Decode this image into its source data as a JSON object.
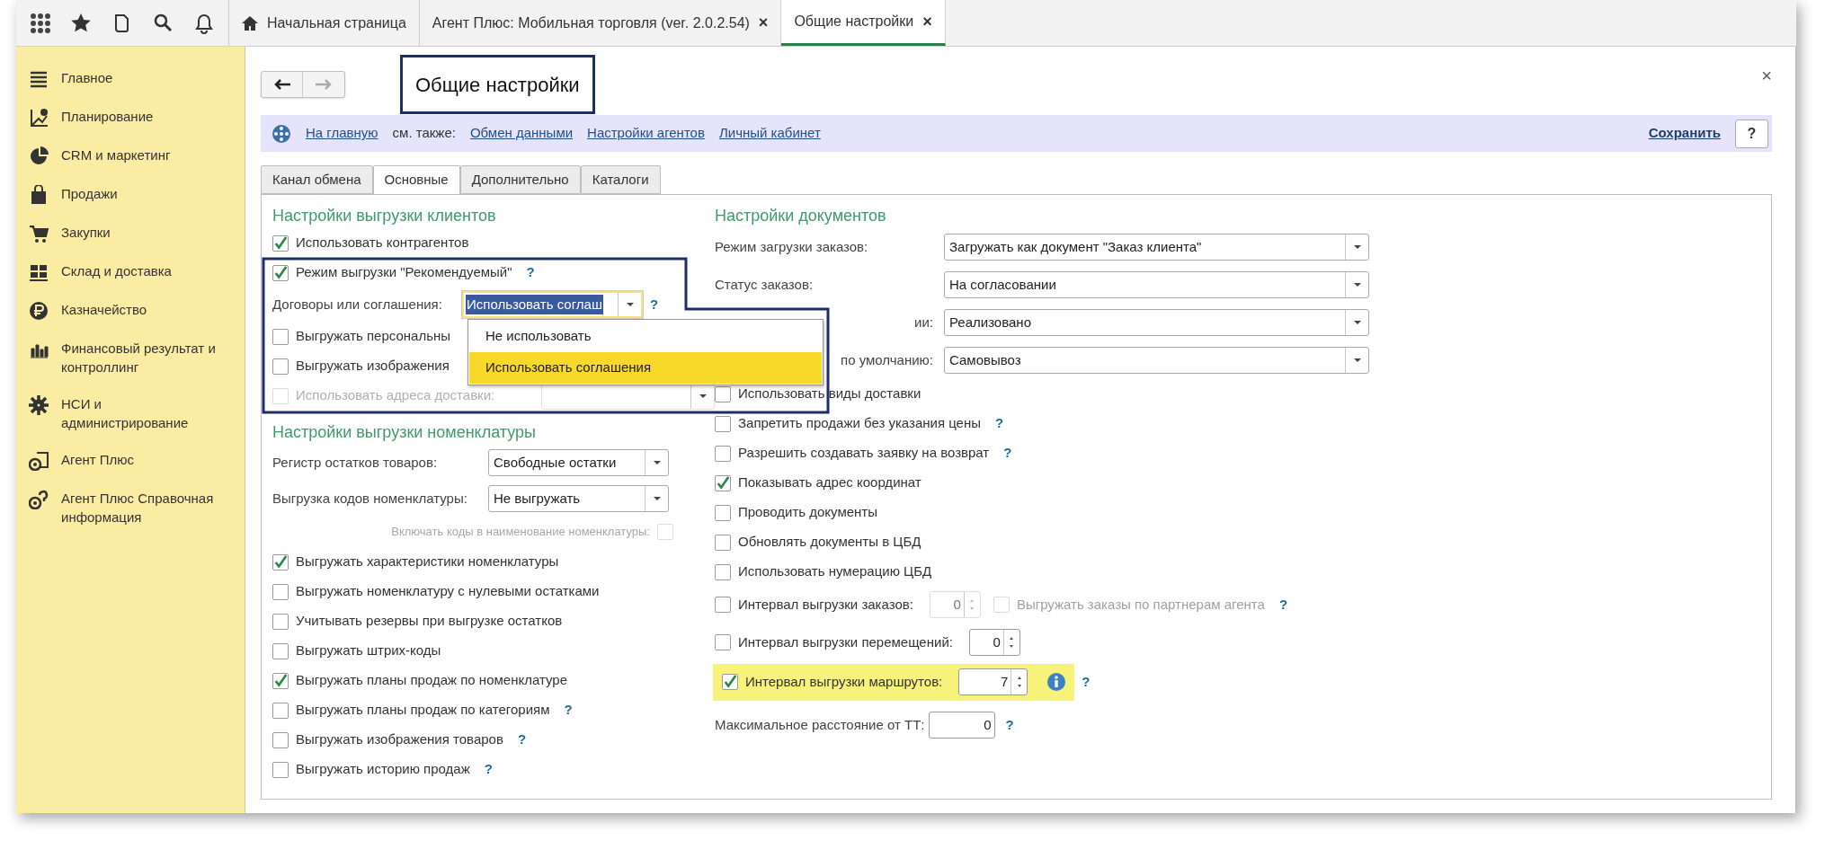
{
  "top_tabs": [
    {
      "kind": "home",
      "label": "Начальная страница",
      "selected": false
    },
    {
      "kind": "doc",
      "label": "Агент Плюс: Мобильная торговля (ver. 2.0.2.54)",
      "close": "×",
      "selected": false
    },
    {
      "kind": "doc",
      "label": "Общие настройки",
      "close": "×",
      "selected": true
    }
  ],
  "sidebar": {
    "items": [
      {
        "label": "Главное"
      },
      {
        "label": "Планирование"
      },
      {
        "label": "CRM и маркетинг"
      },
      {
        "label": "Продажи"
      },
      {
        "label": "Закупки"
      },
      {
        "label": "Склад и доставка"
      },
      {
        "label": "Казначейство"
      },
      {
        "label": "Финансовый результат и контроллинг"
      },
      {
        "label": "НСИ и администрирование"
      },
      {
        "label": "Агент Плюс"
      },
      {
        "label": "Агент Плюс Справочная информация"
      }
    ]
  },
  "form": {
    "title": "Общие настройки",
    "close": "×"
  },
  "command_bar": {
    "home_link": "На главную",
    "see_also": "см. также:",
    "links": [
      "Обмен данными",
      "Настройки агентов",
      "Личный кабинет"
    ],
    "save": "Сохранить",
    "help": "?"
  },
  "form_tabs": [
    {
      "label": "Канал обмена",
      "selected": false
    },
    {
      "label": "Основные",
      "selected": true
    },
    {
      "label": "Дополнительно",
      "selected": false
    },
    {
      "label": "Каталоги",
      "selected": false
    }
  ],
  "clients": {
    "heading": "Настройки выгрузки клиентов",
    "rows": [
      {
        "kind": "checkbox",
        "label": "Использовать контрагентов",
        "checked": true
      },
      {
        "kind": "checkbox",
        "label": "Режим выгрузки \"Рекомендуемый\"",
        "checked": true,
        "help": "?"
      },
      {
        "kind": "select",
        "label": "Договоры или соглашения:",
        "value": "Использовать соглаш",
        "focused": true,
        "help": "?"
      },
      {
        "kind": "checkbox",
        "label": "Выгружать персональны",
        "checked": false
      },
      {
        "kind": "checkbox",
        "label": "Выгружать изображения",
        "checked": false
      },
      {
        "kind": "checkbox_select",
        "label": "Использовать адреса доставки:",
        "checked": false,
        "disabled": true
      }
    ]
  },
  "dropdown_list": {
    "items": [
      {
        "label": "Не использовать",
        "selected": false
      },
      {
        "label": "Использовать соглашения",
        "selected": true
      }
    ]
  },
  "nomenclature": {
    "heading": "Настройки выгрузки номенклатуры",
    "rows": [
      {
        "kind": "select",
        "label": "Регистр остатков товаров:",
        "value": "Свободные остатки"
      },
      {
        "kind": "select",
        "label": "Выгрузка кодов номенклатуры:",
        "value": "Не выгружать"
      },
      {
        "kind": "reverse_checkbox",
        "label": "Включать коды в наименование номенклатуры:",
        "checked": false,
        "disabled": true
      },
      {
        "kind": "checkbox",
        "label": "Выгружать характеристики номенклатуры",
        "checked": true
      },
      {
        "kind": "checkbox",
        "label": "Выгружать номенклатуру с нулевыми остатками",
        "checked": false
      },
      {
        "kind": "checkbox",
        "label": "Учитывать резервы при выгрузке остатков",
        "checked": false
      },
      {
        "kind": "checkbox",
        "label": "Выгружать штрих-коды",
        "checked": false
      },
      {
        "kind": "checkbox",
        "label": "Выгружать планы продаж по номенклатуре",
        "checked": true
      },
      {
        "kind": "checkbox",
        "label": "Выгружать планы продаж по категориям",
        "checked": false,
        "help": "?"
      },
      {
        "kind": "checkbox",
        "label": "Выгружать изображения товаров",
        "checked": false,
        "help": "?"
      },
      {
        "kind": "checkbox",
        "label": "Выгружать историю продаж",
        "checked": false,
        "help": "?"
      }
    ]
  },
  "documents": {
    "heading": "Настройки документов",
    "rows": [
      {
        "kind": "select",
        "label": "Режим загрузки заказов:",
        "value": "Загружать как документ \"Заказ клиента\""
      },
      {
        "kind": "select",
        "label": "Статус заказов:",
        "value": "На согласовании"
      },
      {
        "kind": "select",
        "label": "ии:",
        "label_cut": true,
        "value": "Реализовано"
      },
      {
        "kind": "select",
        "label": "по умолчанию:",
        "label_cut": true,
        "value": "Самовывоз"
      },
      {
        "kind": "checkbox",
        "label": "Использовать виды доставки",
        "checked": false
      },
      {
        "kind": "checkbox",
        "label": "Запретить продажи без указания цены",
        "checked": false,
        "help": "?"
      },
      {
        "kind": "checkbox",
        "label": "Разрешить создавать заявку на возврат",
        "checked": false,
        "help": "?"
      },
      {
        "kind": "checkbox",
        "label": "Показывать адрес координат",
        "checked": true
      },
      {
        "kind": "checkbox",
        "label": "Проводить документы",
        "checked": false
      },
      {
        "kind": "checkbox",
        "label": "Обновлять документы в ЦБД",
        "checked": false
      },
      {
        "kind": "checkbox",
        "label": "Использовать нумерацию ЦБД",
        "checked": false
      },
      {
        "kind": "spin",
        "label": "Интервал выгрузки заказов:",
        "checked": false,
        "value": "0",
        "disabled": true,
        "extra": {
          "label": "Выгружать заказы по партнерам агента",
          "checked": false,
          "disabled": true,
          "help": "?"
        }
      },
      {
        "kind": "spin",
        "label": "Интервал выгрузки перемещений:",
        "checked": false,
        "value": "0"
      },
      {
        "kind": "spin",
        "label": "Интервал выгрузки маршрутов:",
        "checked": true,
        "value": "7",
        "highlighted": true,
        "info": true,
        "help": "?"
      },
      {
        "kind": "number",
        "label": "Максимальное расстояние от ТТ:",
        "value": "0",
        "help": "?"
      }
    ]
  }
}
